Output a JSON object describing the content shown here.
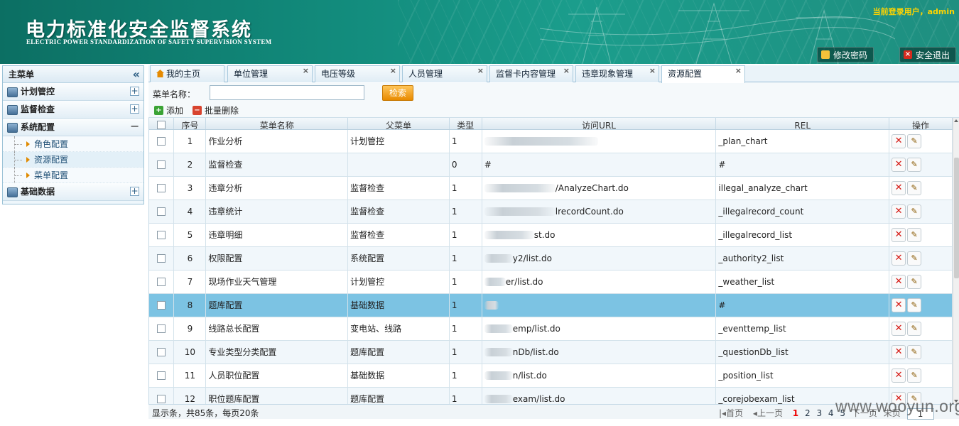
{
  "header": {
    "title": "电力标准化安全监督系统",
    "subtitle": "ELECTRIC POWER STANDARDIZATION OF SAFETY SUPERVISION SYSTEM",
    "user_info": "当前登录用户，admin",
    "change_password": "修改密码",
    "logout": "安全退出"
  },
  "sidebar": {
    "title": "主菜单",
    "groups": [
      {
        "label": "计划管控",
        "toggle": "+"
      },
      {
        "label": "监督检查",
        "toggle": "+"
      },
      {
        "label": "系统配置",
        "toggle": "−"
      },
      {
        "label": "基础数据",
        "toggle": "+"
      }
    ],
    "sub_items": [
      "角色配置",
      "资源配置",
      "菜单配置"
    ]
  },
  "tabs": [
    "我的主页",
    "单位管理",
    "电压等级",
    "人员管理",
    "监督卡内容管理",
    "违章现象管理",
    "资源配置"
  ],
  "search": {
    "label": "菜单名称：",
    "value": "",
    "button": "检索"
  },
  "toolbar": {
    "add": "添加",
    "batch_delete": "批量删除"
  },
  "table": {
    "columns": [
      "序号",
      "菜单名称",
      "父菜单",
      "类型",
      "访问URL",
      "REL",
      "操作"
    ],
    "rows": [
      {
        "no": "1",
        "name": "作业分析",
        "parent": "计划管控",
        "type": "1",
        "url": "",
        "rel": "_plan_chart"
      },
      {
        "no": "2",
        "name": "监督检查",
        "parent": "",
        "type": "0",
        "url": "#",
        "rel": "#"
      },
      {
        "no": "3",
        "name": "违章分析",
        "parent": "监督检查",
        "type": "1",
        "url": "/AnalyzeChart.do",
        "rel": "illegal_analyze_chart"
      },
      {
        "no": "4",
        "name": "违章统计",
        "parent": "监督检查",
        "type": "1",
        "url": "lrecordCount.do",
        "rel": "_illegalrecord_count"
      },
      {
        "no": "5",
        "name": "违章明细",
        "parent": "监督检查",
        "type": "1",
        "url": "st.do",
        "rel": "_illegalrecord_list"
      },
      {
        "no": "6",
        "name": "权限配置",
        "parent": "系统配置",
        "type": "1",
        "url": "y2/list.do",
        "rel": "_authority2_list"
      },
      {
        "no": "7",
        "name": "现场作业天气管理",
        "parent": "计划管控",
        "type": "1",
        "url": "er/list.do",
        "rel": "_weather_list"
      },
      {
        "no": "8",
        "name": "题库配置",
        "parent": "基础数据",
        "type": "1",
        "url": "",
        "rel": "#"
      },
      {
        "no": "9",
        "name": "线路总长配置",
        "parent": "变电站、线路",
        "type": "1",
        "url": "emp/list.do",
        "rel": "_eventtemp_list"
      },
      {
        "no": "10",
        "name": "专业类型分类配置",
        "parent": "题库配置",
        "type": "1",
        "url": "nDb/list.do",
        "rel": "_questionDb_list"
      },
      {
        "no": "11",
        "name": "人员职位配置",
        "parent": "基础数据",
        "type": "1",
        "url": "n/list.do",
        "rel": "_position_list"
      },
      {
        "no": "12",
        "name": "职位题库配置",
        "parent": "题库配置",
        "type": "1",
        "url": "exam/list.do",
        "rel": "_corejobexam_list"
      }
    ],
    "selected_row": 8
  },
  "pager": {
    "info": "显示条，共85条，每页20条",
    "first": "首页",
    "prev": "上一页",
    "pages": [
      "1",
      "2",
      "3",
      "4",
      "5"
    ],
    "current": "1",
    "next": "下一页",
    "last": "末页",
    "page_input": "1"
  },
  "watermark": "www.wooyun.org"
}
